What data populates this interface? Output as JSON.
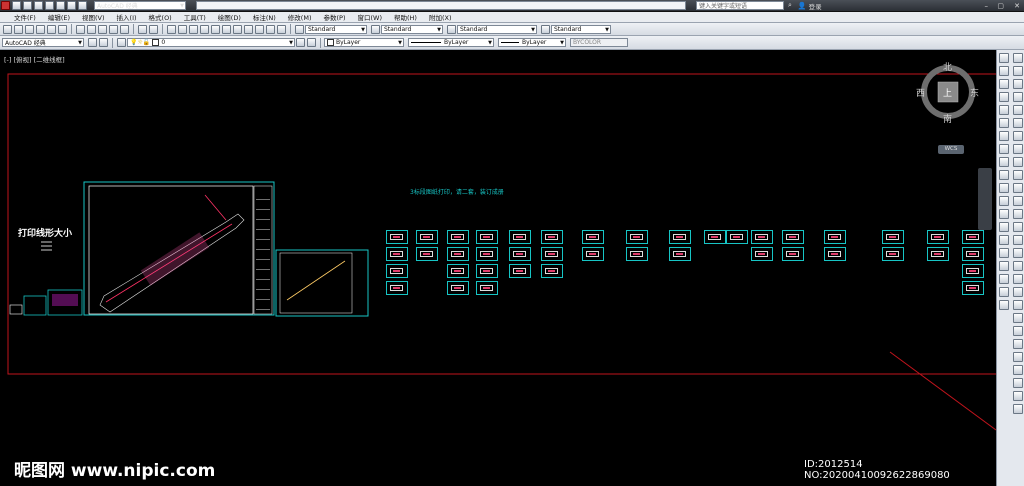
{
  "title_bar": {
    "workspace": "AutoCAD 经典",
    "search_placeholder": "键入关键字或短语",
    "login": "登录"
  },
  "menu": [
    "文件(F)",
    "编辑(E)",
    "视图(V)",
    "插入(I)",
    "格式(O)",
    "工具(T)",
    "绘图(D)",
    "标注(N)",
    "修改(M)",
    "参数(P)",
    "窗口(W)",
    "帮助(H)",
    "附加(X)"
  ],
  "toolbar1": {
    "text_style": "Standard",
    "dim_style": "Standard",
    "table_style": "Standard",
    "mleader_style": "Standard"
  },
  "toolbar2": {
    "workspace": "AutoCAD 经典",
    "layer": "0",
    "color": "ByLayer",
    "linetype": "ByLayer",
    "lineweight": "ByLayer",
    "plotstyle": "BYCOLOR"
  },
  "viewport": {
    "label": "[-] [俯视] [二维线框]"
  },
  "viewcube": {
    "north": "北",
    "south": "南",
    "east": "东",
    "west": "西",
    "top": "上",
    "wcs": "WCS"
  },
  "drawing": {
    "left_label": "打印线形大小",
    "note": "3标段图纸打印，请二套，装订成册"
  },
  "watermark": {
    "site": "昵图网 www.nipic.com",
    "id": "ID:2012514 NO:20200410092622869080"
  },
  "colors": {
    "cyan": "#17c5c5",
    "red_border": "#c0141c",
    "background": "#000000"
  }
}
